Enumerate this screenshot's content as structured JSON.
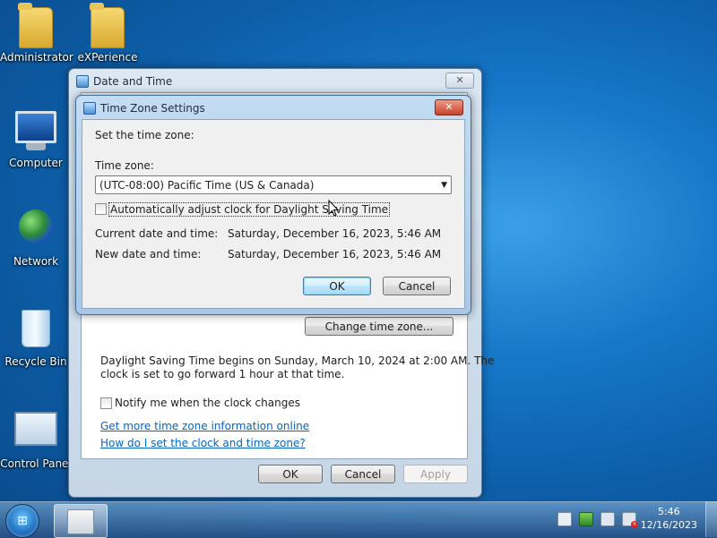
{
  "desktop": {
    "icons": [
      {
        "label": "Administrator"
      },
      {
        "label": "eXPerience"
      },
      {
        "label": "Computer"
      },
      {
        "label": "Network"
      },
      {
        "label": "Recycle Bin"
      },
      {
        "label": "Control Panel"
      }
    ]
  },
  "date_time_window": {
    "title": "Date and Time",
    "close_label": "✕",
    "change_time_zone_button": "Change time zone...",
    "dst_text_line1": "Daylight Saving Time begins on Sunday, March 10, 2024 at 2:00 AM. The",
    "dst_text_line2": "clock is set to go forward 1 hour at that time.",
    "notify_label": "Notify me when the clock changes",
    "link_more_info": "Get more time zone information online",
    "link_how_to": "How do I set the clock and time zone?",
    "ok_label": "OK",
    "cancel_label": "Cancel",
    "apply_label": "Apply"
  },
  "tz_dialog": {
    "title": "Time Zone Settings",
    "close_label": "✕",
    "heading": "Set the time zone:",
    "time_zone_label": "Time zone:",
    "time_zone_value": "(UTC-08:00) Pacific Time (US & Canada)",
    "auto_adjust_label": "Automatically adjust clock for Daylight Saving Time",
    "current_label": "Current date and time:",
    "current_value": "Saturday, December 16, 2023, 5:46 AM",
    "new_label": "New date and time:",
    "new_value": "Saturday, December 16, 2023, 5:46 AM",
    "ok_label": "OK",
    "cancel_label": "Cancel"
  },
  "taskbar": {
    "time": "5:46",
    "date": "12/16/2023"
  }
}
